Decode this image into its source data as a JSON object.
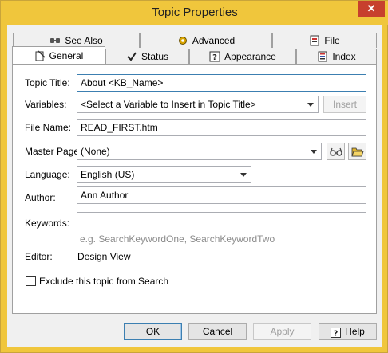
{
  "window": {
    "title": "Topic Properties",
    "close_glyph": "✕"
  },
  "tabs_back": [
    {
      "label": "See Also",
      "icon": "see-also-icon"
    },
    {
      "label": "Advanced",
      "icon": "gear-icon"
    },
    {
      "label": "File",
      "icon": "file-icon"
    }
  ],
  "tabs_front": [
    {
      "label": "General",
      "icon": "general-icon",
      "active": true
    },
    {
      "label": "Status",
      "icon": "checkmark-icon"
    },
    {
      "label": "Appearance",
      "icon": "help-question-icon"
    },
    {
      "label": "Index",
      "icon": "index-icon"
    }
  ],
  "form": {
    "topic_title_label": "Topic Title:",
    "topic_title_value": "About <KB_Name>",
    "variables_label": "Variables:",
    "variables_value": "<Select a Variable to Insert in Topic Title>",
    "insert_label": "Insert",
    "file_name_label": "File Name:",
    "file_name_value": "READ_FIRST.htm",
    "master_page_label": "Master Page:",
    "master_page_value": "(None)",
    "language_label": "Language:",
    "language_value": "English (US)",
    "author_label": "Author:",
    "author_value": "Ann Author",
    "keywords_label": "Keywords:",
    "keywords_value": "",
    "keywords_hint": "e.g. SearchKeywordOne, SearchKeywordTwo",
    "editor_label": "Editor:",
    "editor_value": "Design View",
    "exclude_label": "Exclude this topic from Search",
    "exclude_checked": false
  },
  "footer": {
    "ok": "OK",
    "cancel": "Cancel",
    "apply": "Apply",
    "help": "Help"
  },
  "colors": {
    "titlebar": "#f0c63c",
    "close": "#c7402d",
    "focus_border": "#3c7fb1"
  }
}
